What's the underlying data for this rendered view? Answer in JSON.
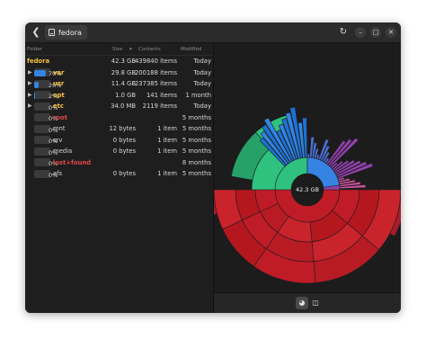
{
  "header": {
    "location": "fedora",
    "back_icon": "go-back-icon",
    "reload_icon": "reload-icon"
  },
  "columns": {
    "folder": "Folder",
    "size": "Size",
    "contents": "Contents",
    "modified": "Modified"
  },
  "root": {
    "name": "fedora",
    "size": "42.3 GB",
    "contents": "439840 items",
    "modified": "Today"
  },
  "rows": [
    {
      "expandable": true,
      "pct": "70%",
      "fill": 0.7,
      "name": "var",
      "name_color": "#f6c343",
      "size": "29.8 GB",
      "contents": "200188 items",
      "modified": "Today"
    },
    {
      "expandable": true,
      "pct": "26%",
      "fill": 0.26,
      "name": "usr",
      "name_color": "#f6c343",
      "size": "11.4 GB",
      "contents": "237385 items",
      "modified": "Today"
    },
    {
      "expandable": true,
      "pct": "2%",
      "fill": 0.02,
      "name": "opt",
      "name_color": "#f6c343",
      "size": "1.0 GB",
      "contents": "141 items",
      "modified": "1 month"
    },
    {
      "expandable": true,
      "pct": "0%",
      "fill": 0.0,
      "name": "etc",
      "name_color": "#f6c343",
      "size": "34.0 MB",
      "contents": "2119 items",
      "modified": "Today"
    },
    {
      "expandable": false,
      "pct": "0%",
      "fill": 0.0,
      "name": "root",
      "name_color": "#e0464a",
      "size": "",
      "contents": "",
      "modified": "5 months"
    },
    {
      "expandable": false,
      "pct": "0%",
      "fill": 0.0,
      "name": "mnt",
      "name_color": "#d8d8d8",
      "size": "12 bytes",
      "contents": "1 item",
      "modified": "5 months"
    },
    {
      "expandable": false,
      "pct": "0%",
      "fill": 0.0,
      "name": "srv",
      "name_color": "#d8d8d8",
      "size": "0 bytes",
      "contents": "1 item",
      "modified": "5 months"
    },
    {
      "expandable": false,
      "pct": "0%",
      "fill": 0.0,
      "name": "media",
      "name_color": "#d8d8d8",
      "size": "0 bytes",
      "contents": "1 item",
      "modified": "5 months"
    },
    {
      "expandable": false,
      "pct": "0%",
      "fill": 0.0,
      "name": "lost+found",
      "name_color": "#e0464a",
      "size": "",
      "contents": "",
      "modified": "8 months"
    },
    {
      "expandable": false,
      "pct": "0%",
      "fill": 0.0,
      "name": "afs",
      "name_color": "#d8d8d8",
      "size": "0 bytes",
      "contents": "1 item",
      "modified": "5 months"
    }
  ],
  "chart": {
    "center_label": "42.3 GB"
  },
  "bottom": {
    "active_view": "rings-chart",
    "other_view": "treemap-chart"
  }
}
